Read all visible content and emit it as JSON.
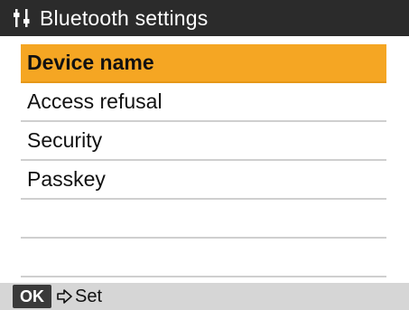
{
  "header": {
    "title": "Bluetooth settings",
    "icon": "settings-icon"
  },
  "menu": {
    "items": [
      {
        "label": "Device name",
        "selected": true
      },
      {
        "label": "Access refusal",
        "selected": false
      },
      {
        "label": "Security",
        "selected": false
      },
      {
        "label": "Passkey",
        "selected": false
      },
      {
        "label": "",
        "selected": false
      },
      {
        "label": "",
        "selected": false
      }
    ]
  },
  "footer": {
    "ok_label": "OK",
    "action_icon": "arrow-right-icon",
    "action_label": "Set"
  },
  "colors": {
    "title_bar": "#2b2b2b",
    "selection": "#f5a623",
    "footer_bar": "#d6d6d6"
  }
}
